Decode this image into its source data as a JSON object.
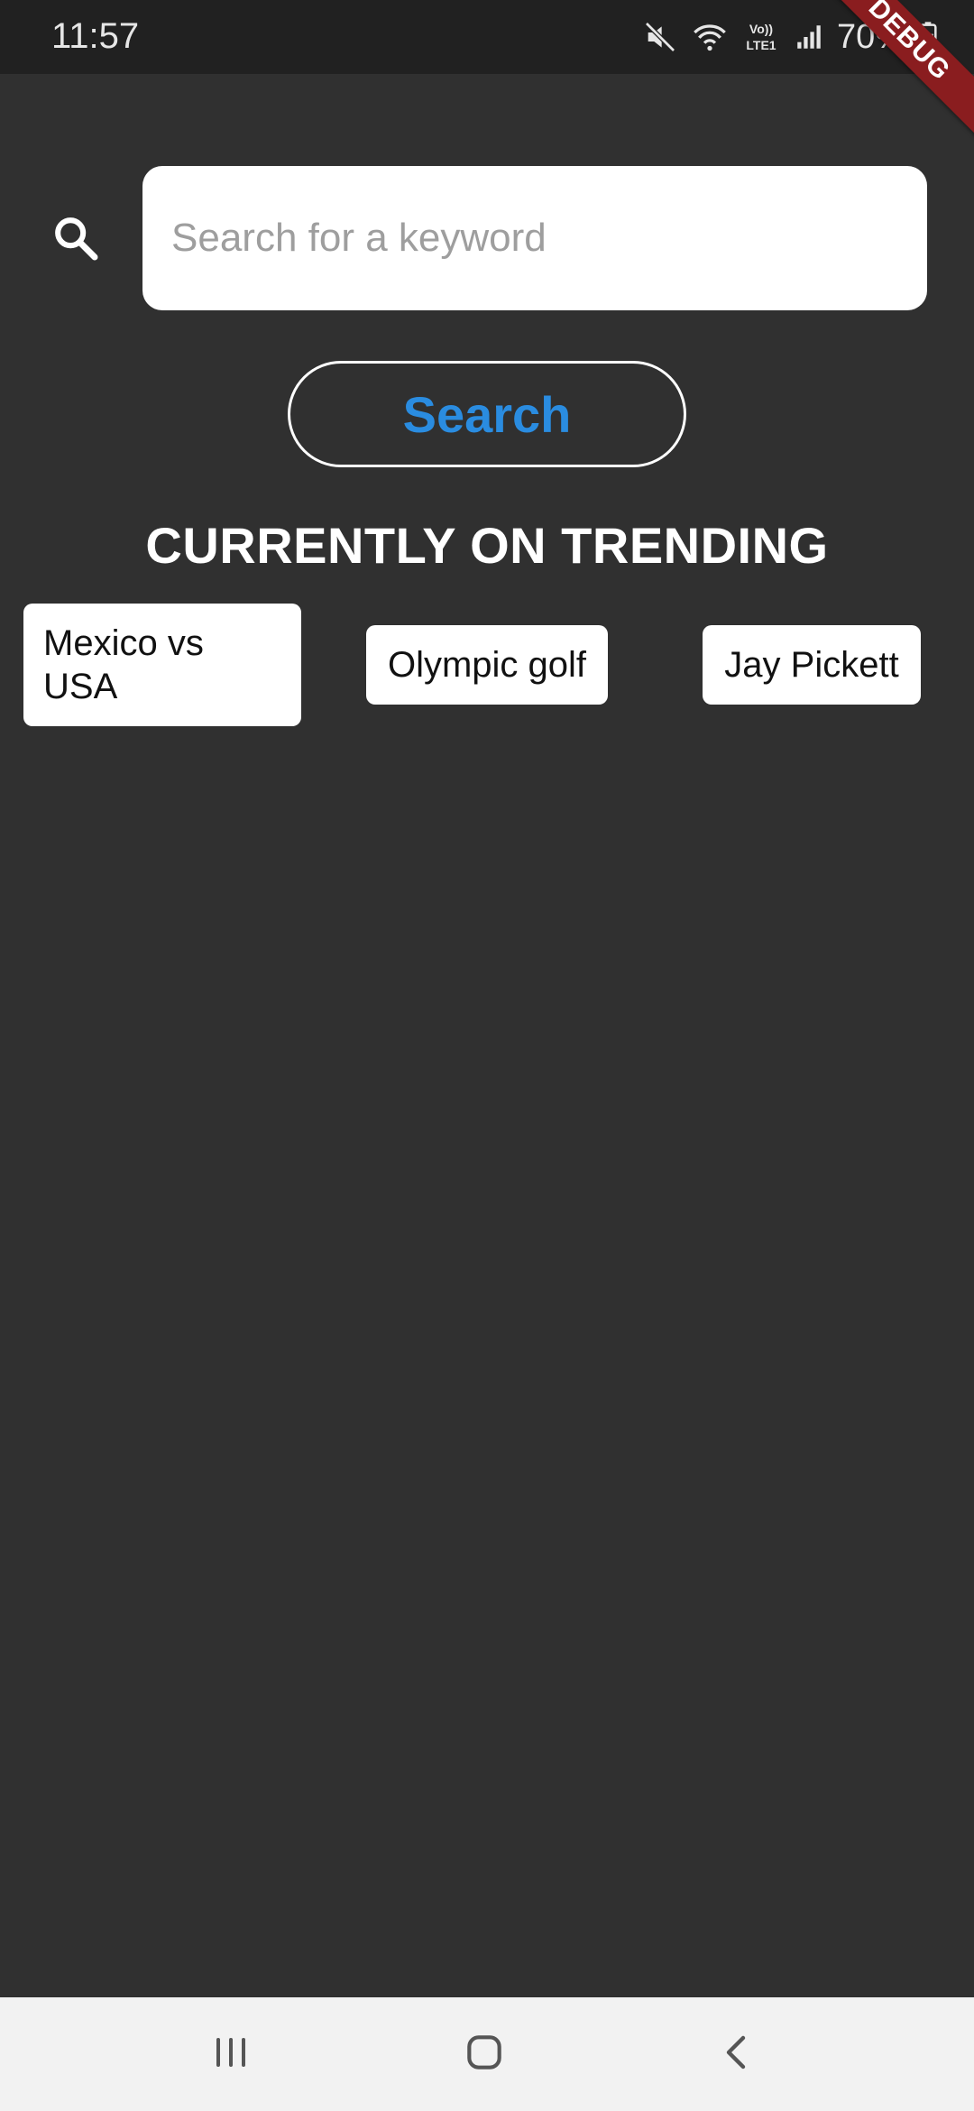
{
  "status_bar": {
    "time": "11:57",
    "battery": "70%",
    "icons": [
      "mute-icon",
      "wifi-icon",
      "volte-icon",
      "signal-icon",
      "battery-icon"
    ],
    "volte_label": "Vo)) LTE1"
  },
  "debug_banner": {
    "label": "DEBUG",
    "color": "#8a1d1f"
  },
  "search": {
    "icon": "search-icon",
    "placeholder": "Search for a keyword",
    "value": "",
    "button_label": "Search",
    "button_color": "#2a8ce0"
  },
  "trending": {
    "title": "CURRENTLY ON TRENDING",
    "items": [
      {
        "label": "Mexico vs USA"
      },
      {
        "label": "Olympic golf"
      },
      {
        "label": "Jay Pickett"
      }
    ]
  },
  "nav_bar": {
    "icons": [
      "recent-apps-icon",
      "home-icon",
      "back-icon"
    ]
  },
  "colors": {
    "background": "#303030",
    "status_bar": "#212121",
    "nav_bar": "#f2f2f2"
  }
}
